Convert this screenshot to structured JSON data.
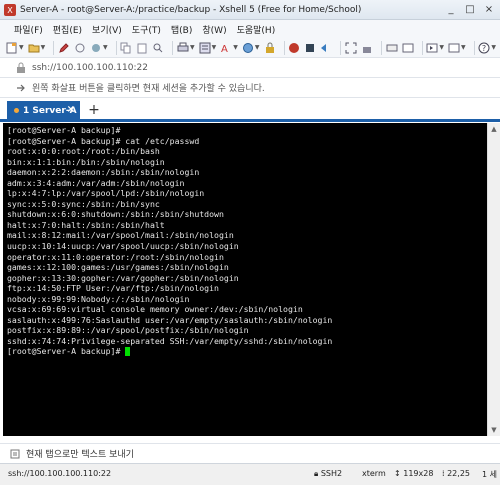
{
  "window": {
    "title": "Server-A - root@Server-A:/practice/backup - Xshell 5 (Free for Home/School)",
    "controls": [
      "_",
      "□",
      "×"
    ]
  },
  "menu": [
    "파일(F)",
    "편집(E)",
    "보기(V)",
    "도구(T)",
    "탭(B)",
    "창(W)",
    "도움말(H)"
  ],
  "address": {
    "text": "ssh://100.100.100.110:22"
  },
  "info": {
    "text": "왼쪽 화살표 버튼을 클릭하면 현재 세션을 추가할 수 있습니다."
  },
  "tabs": {
    "active_label": "1 Server-A",
    "add_label": "+"
  },
  "terminal": {
    "lines": [
      "[root@Server-A backup]#",
      "[root@Server-A backup]# cat /etc/passwd",
      "root:x:0:0:root:/root:/bin/bash",
      "bin:x:1:1:bin:/bin:/sbin/nologin",
      "daemon:x:2:2:daemon:/sbin:/sbin/nologin",
      "adm:x:3:4:adm:/var/adm:/sbin/nologin",
      "lp:x:4:7:lp:/var/spool/lpd:/sbin/nologin",
      "sync:x:5:0:sync:/sbin:/bin/sync",
      "shutdown:x:6:0:shutdown:/sbin:/sbin/shutdown",
      "halt:x:7:0:halt:/sbin:/sbin/halt",
      "mail:x:8:12:mail:/var/spool/mail:/sbin/nologin",
      "uucp:x:10:14:uucp:/var/spool/uucp:/sbin/nologin",
      "operator:x:11:0:operator:/root:/sbin/nologin",
      "games:x:12:100:games:/usr/games:/sbin/nologin",
      "gopher:x:13:30:gopher:/var/gopher:/sbin/nologin",
      "ftp:x:14:50:FTP User:/var/ftp:/sbin/nologin",
      "nobody:x:99:99:Nobody:/:/sbin/nologin",
      "vcsa:x:69:69:virtual console memory owner:/dev:/sbin/nologin",
      "saslauth:x:499:76:Saslauthd user:/var/empty/saslauth:/sbin/nologin",
      "postfix:x:89:89::/var/spool/postfix:/sbin/nologin",
      "sshd:x:74:74:Privilege-separated SSH:/var/empty/sshd:/sbin/nologin"
    ],
    "prompt": "[root@Server-A backup]# "
  },
  "compose": {
    "text": "현재 탭으로만 텍스트 보내기"
  },
  "status": {
    "address": "ssh://100.100.100.110:22",
    "protocol": "SSH2",
    "term": "xterm",
    "size": "119x28",
    "position": "22,25",
    "sessions": "1 세"
  },
  "colors": {
    "tab_active": "#1d5fa8",
    "cursor": "#00e000",
    "terminal_bg": "#000000"
  }
}
